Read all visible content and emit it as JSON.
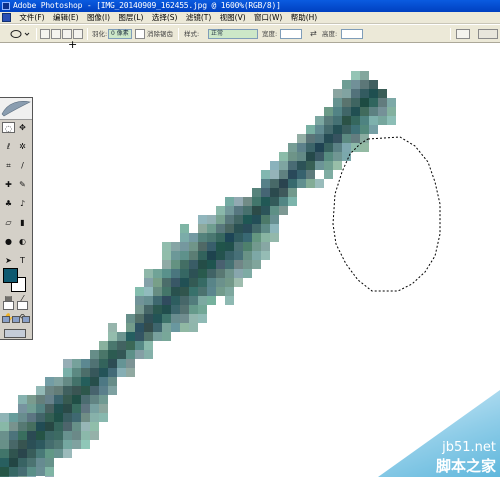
{
  "window": {
    "title": "Adobe Photoshop - [IMG_20140909_162455.jpg @ 1600%(RGB/8)]"
  },
  "menu": {
    "items": [
      "文件(F)",
      "编辑(E)",
      "图像(I)",
      "图层(L)",
      "选择(S)",
      "滤镜(T)",
      "视图(V)",
      "窗口(W)",
      "帮助(H)"
    ]
  },
  "options": {
    "feather_label": "羽化:",
    "feather_value": "0 像素",
    "antialias_label": "消除锯齿",
    "style_label": "样式:",
    "style_value": "正常",
    "width_label": "宽度:",
    "height_label": "高度:"
  },
  "watermark": {
    "site": "jb51.net",
    "brand": "脚本之家"
  },
  "colors": {
    "foreground": "#0e5970",
    "background": "#ffffff",
    "title_bar": "#0a5be0",
    "brush_stroke": "#1f5a5a"
  },
  "tools": [
    "marquee-icon",
    "move-icon",
    "lasso-icon",
    "magic-wand-icon",
    "crop-icon",
    "slice-icon",
    "healing-brush-icon",
    "brush-icon",
    "clone-stamp-icon",
    "history-brush-icon",
    "eraser-icon",
    "gradient-icon",
    "blur-icon",
    "dodge-icon",
    "path-selection-icon",
    "type-icon",
    "pen-icon",
    "shape-icon",
    "notes-icon",
    "eyedropper-icon",
    "hand-icon",
    "zoom-icon"
  ]
}
